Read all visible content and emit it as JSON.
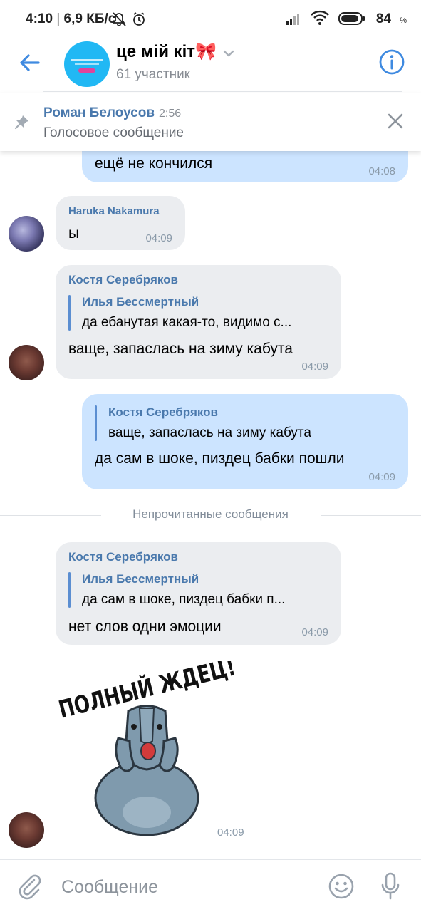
{
  "status_bar": {
    "time": "4:10",
    "speed": "6,9 КБ/с",
    "battery": "84",
    "battery_unit": "%"
  },
  "header": {
    "title": "це мій кіт🎀",
    "subtitle": "61 участник"
  },
  "pinned": {
    "name": "Роман Белоусов",
    "time": "2:56",
    "text": "Голосовое сообщение"
  },
  "messages": [
    {
      "type": "out",
      "text": "ещё не кончился",
      "time": "04:08"
    },
    {
      "type": "in",
      "sender": "Haruka Nakamura",
      "text": "ы",
      "time": "04:09"
    },
    {
      "type": "in",
      "sender": "Костя Серебряков",
      "reply_name": "Илья Бессмертный",
      "reply_text": "да ебанутая какая-то, видимо с...",
      "text": "ваще, запаслась на зиму кабута",
      "time": "04:09"
    },
    {
      "type": "out",
      "reply_name": "Костя Серебряков",
      "reply_text": "ваще, запаслась на зиму кабута",
      "text": "да сам в шоке, пиздец бабки пошли",
      "time": "04:09"
    },
    {
      "type": "in",
      "sender": "Костя Серебряков",
      "reply_name": "Илья Бессмертный",
      "reply_text": "да сам в шоке, пиздец бабки п...",
      "text": "нет слов одни эмоции",
      "time": "04:09"
    },
    {
      "type": "sticker",
      "sticker_text": "ПОЛНЫЙ ЖДЕЦ!",
      "time": "04:09"
    }
  ],
  "unread_label": "Непрочитанные сообщения",
  "composer": {
    "placeholder": "Сообщение"
  },
  "colors": {
    "accent": "#3f8ae0",
    "incoming_bubble": "#ebedf0",
    "outgoing_bubble": "#cce4ff",
    "name": "#4a79ad"
  },
  "icons": [
    "back-arrow-icon",
    "chevron-down-icon",
    "info-icon",
    "pin-icon",
    "close-icon",
    "attach-icon",
    "emoji-icon",
    "mic-icon"
  ]
}
